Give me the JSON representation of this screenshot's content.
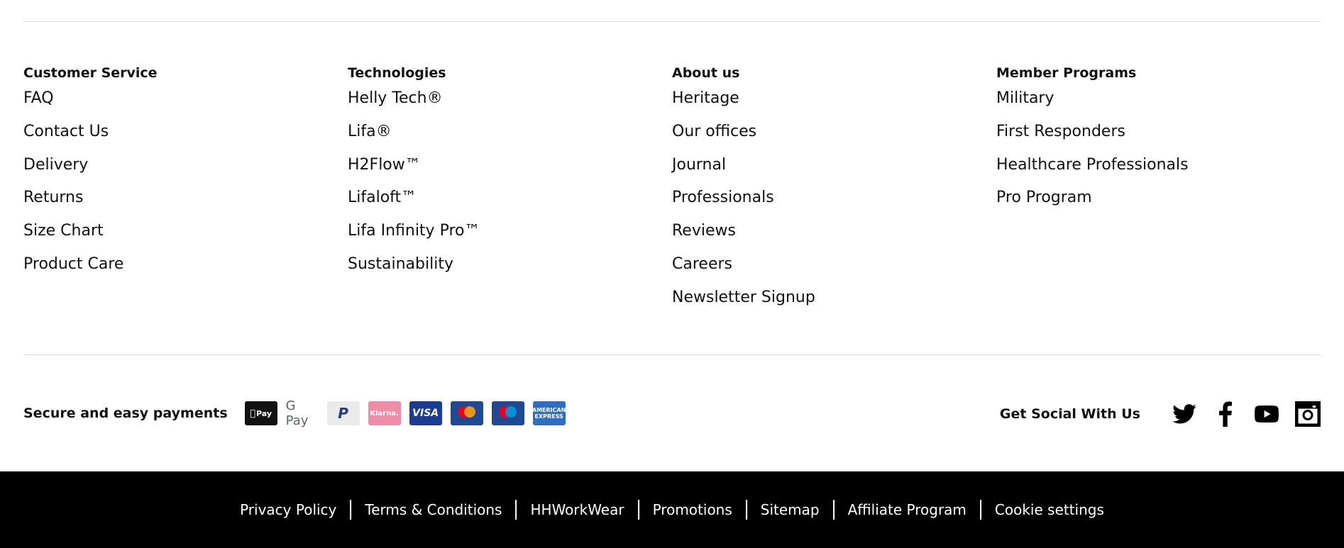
{
  "columns": [
    {
      "heading": "Customer Service",
      "links": [
        "FAQ",
        "Contact Us",
        "Delivery",
        "Returns",
        "Size Chart",
        "Product Care"
      ]
    },
    {
      "heading": "Technologies",
      "links": [
        "Helly Tech®",
        "Lifa®",
        "H2Flow™",
        "Lifaloft™",
        "Lifa Infinity Pro™",
        "Sustainability"
      ]
    },
    {
      "heading": "About us",
      "links": [
        "Heritage",
        "Our offices",
        "Journal",
        "Professionals",
        "Reviews",
        "Careers",
        "Newsletter Signup"
      ]
    },
    {
      "heading": "Member Programs",
      "links": [
        "Military",
        "First Responders",
        "Healthcare Professionals",
        "Pro Program"
      ]
    }
  ],
  "payments": {
    "label": "Secure and easy payments",
    "methods": [
      {
        "name": "apple-pay-icon",
        "text": "Pay"
      },
      {
        "name": "google-pay-icon",
        "text": "G Pay"
      },
      {
        "name": "paypal-icon",
        "text": "P"
      },
      {
        "name": "klarna-icon",
        "text": "Klarna."
      },
      {
        "name": "visa-icon",
        "text": "VISA"
      },
      {
        "name": "mastercard-icon",
        "text": ""
      },
      {
        "name": "maestro-icon",
        "text": ""
      },
      {
        "name": "amex-icon",
        "text": "AMERICAN EXPRESS"
      }
    ]
  },
  "social": {
    "label": "Get Social With Us",
    "icons": [
      "twitter-icon",
      "facebook-icon",
      "youtube-icon",
      "instagram-icon"
    ]
  },
  "legal": [
    "Privacy Policy",
    "Terms & Conditions",
    "HHWorkWear",
    "Promotions",
    "Sitemap",
    "Affiliate Program",
    "Cookie settings"
  ],
  "colors": {
    "footer_bar": "#000000",
    "rule": "#dcdcdc",
    "text": "#111111"
  }
}
